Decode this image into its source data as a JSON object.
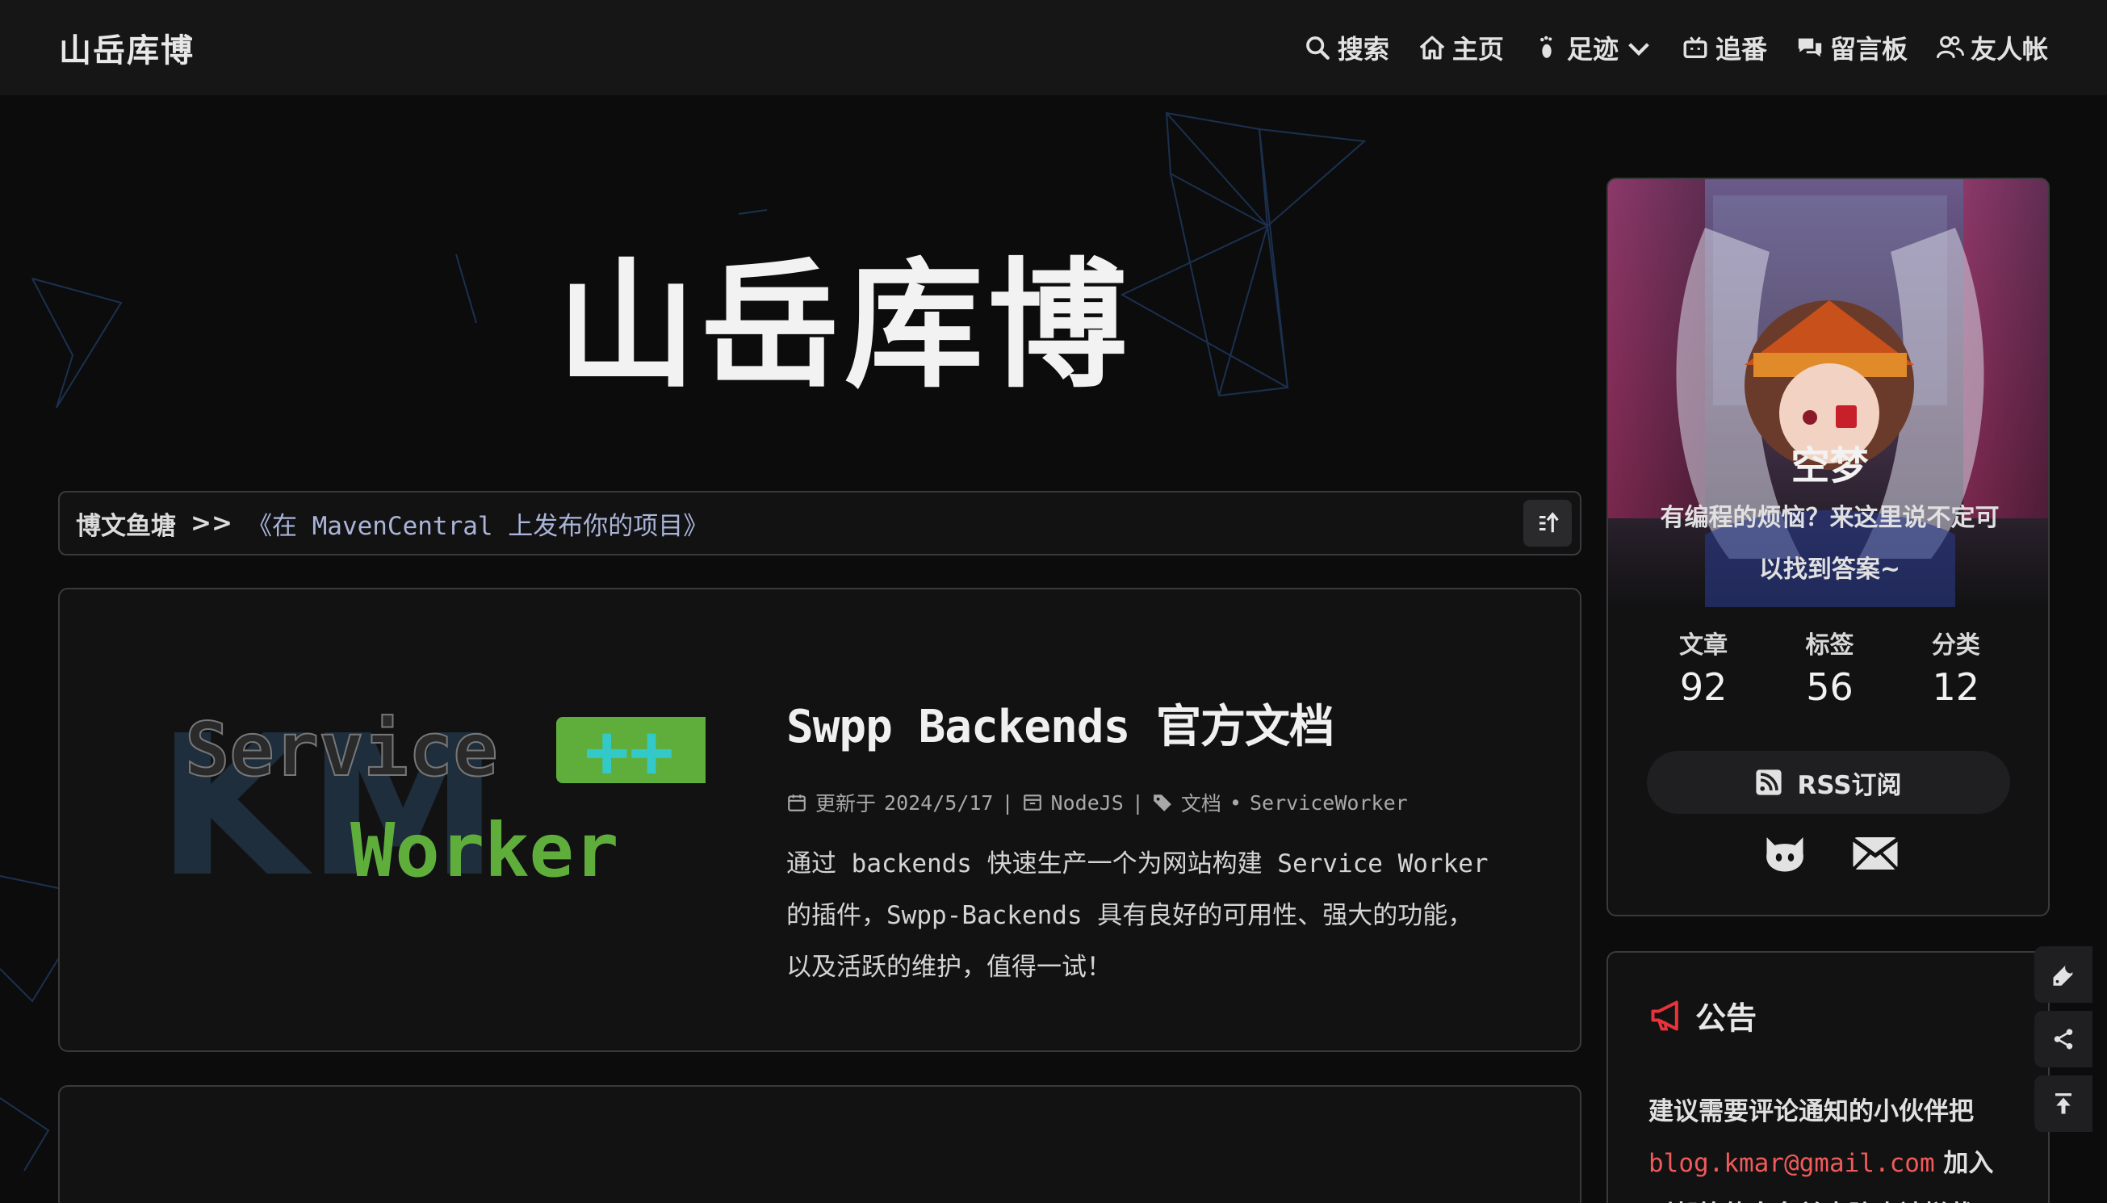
{
  "nav": {
    "brand": "山岳库博",
    "items": [
      {
        "icon": "search-icon",
        "label": "搜索"
      },
      {
        "icon": "home-icon",
        "label": "主页"
      },
      {
        "icon": "footprint-icon",
        "label": "足迹"
      },
      {
        "icon": "tv-icon",
        "label": "追番"
      },
      {
        "icon": "comments-icon",
        "label": "留言板"
      },
      {
        "icon": "users-icon",
        "label": "友人帐"
      }
    ]
  },
  "hero": {
    "title": "山岳库博"
  },
  "breadcrumb": {
    "site": "博文鱼塘",
    "separator": ">>",
    "link": "《在 MavenCentral 上发布你的项目》"
  },
  "post": {
    "cover": {
      "top_text": "Service",
      "badge": "++",
      "bottom_text": "Worker",
      "watermark": "KM"
    },
    "title": "Swpp Backends 官方文档",
    "updated_label": "更新于",
    "date": "2024/5/17",
    "category": "NodeJS",
    "tags": [
      "文档",
      "ServiceWorker"
    ],
    "description_lines": [
      "通过 backends 快速生产一个为网站构建 Service Worker",
      "的插件，Swpp-Backends 具有良好的可用性、强大的功能，",
      "以及活跃的维护，值得一试！"
    ]
  },
  "profile": {
    "name": "空梦",
    "bio_lines": [
      "有编程的烦恼？来这里说不定可",
      "以找到答案~"
    ],
    "stats": [
      {
        "label": "文章",
        "value": "92"
      },
      {
        "label": "标签",
        "value": "56"
      },
      {
        "label": "分类",
        "value": "12"
      }
    ],
    "rss_label": "RSS订阅",
    "socials": [
      "github-icon",
      "mail-icon"
    ]
  },
  "notice": {
    "title": "公告",
    "line1": "建议需要评论通知的小伙伴把",
    "email": "blog.kmar@gmail.com",
    "line2_suffix": " 加入",
    "line3": "到邮箱的白名单中防止被拦截"
  },
  "tools": [
    "wrench-icon",
    "share-icon",
    "back-to-top-icon"
  ],
  "colors": {
    "accent_red": "#f05a5a",
    "link_blue": "#aab4d8",
    "badge_green": "#5fae3c",
    "badge_cyan": "#33c9c9"
  }
}
